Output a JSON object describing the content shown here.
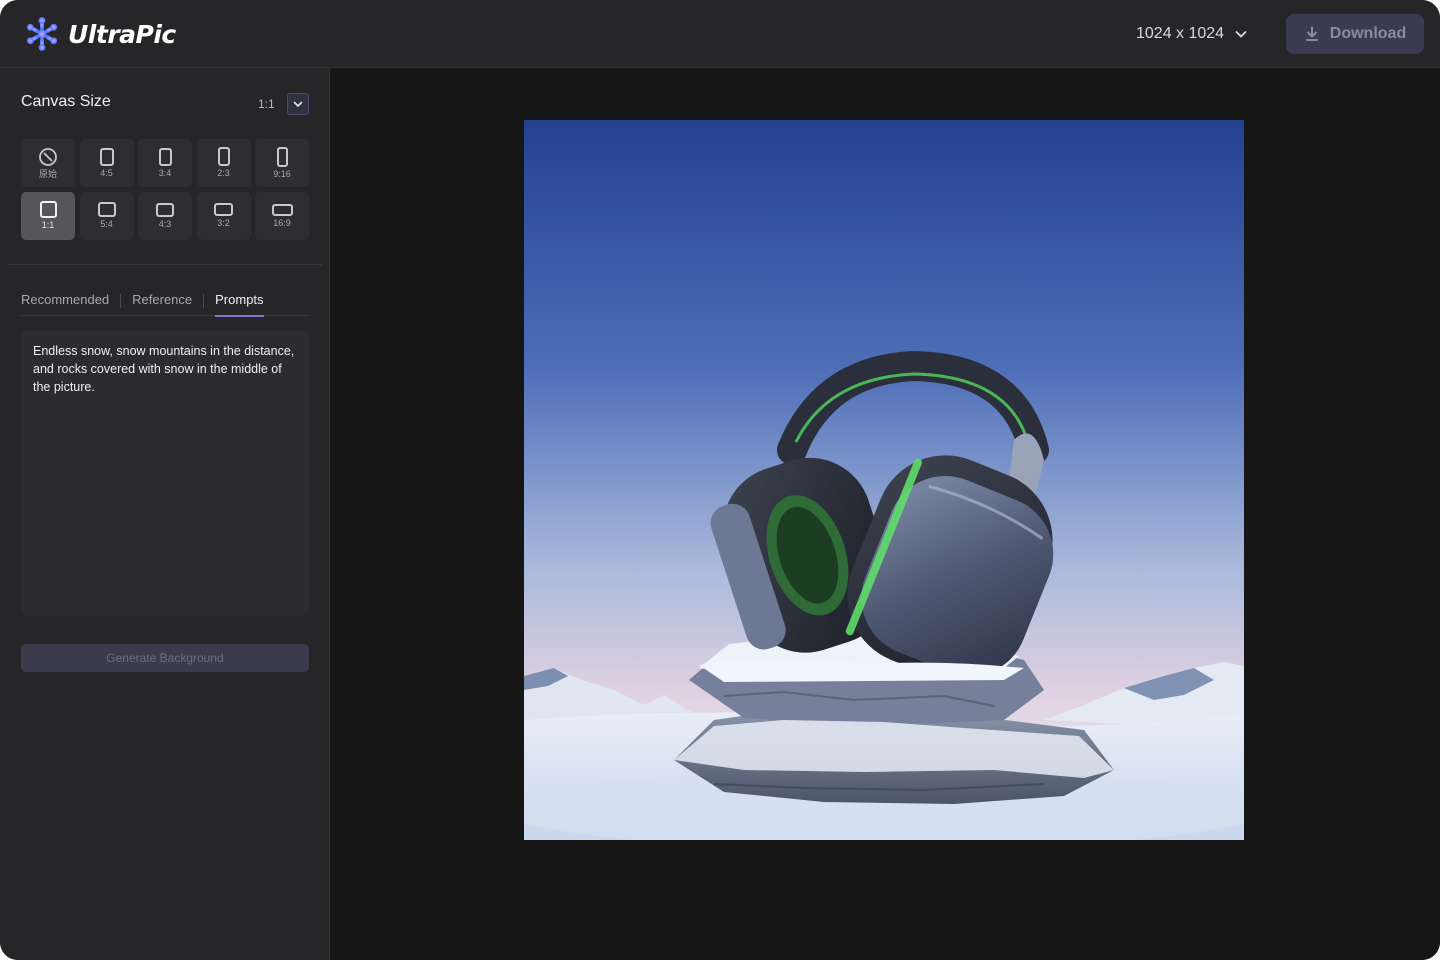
{
  "app": {
    "name": "UltraPic",
    "logo_icon": "snowflake-logo-icon"
  },
  "topbar": {
    "size_value": "1024 x 1024",
    "size_icon": "chevron-down-icon",
    "download_label": "Download",
    "download_icon": "download-icon"
  },
  "sidebar": {
    "canvas_title": "Canvas Size",
    "canvas_ratio": "1:1",
    "ratios": [
      {
        "label": "原始",
        "icon": "no-ratio-icon",
        "active": false
      },
      {
        "label": "4:5",
        "active": false
      },
      {
        "label": "3:4",
        "active": false
      },
      {
        "label": "2:3",
        "active": false
      },
      {
        "label": "9:16",
        "active": false
      },
      {
        "label": "1:1",
        "active": true
      },
      {
        "label": "5:4",
        "active": false
      },
      {
        "label": "4:3",
        "active": false
      },
      {
        "label": "3:2",
        "active": false
      },
      {
        "label": "16:9",
        "active": false
      }
    ],
    "tabs": [
      {
        "label": "Recommended",
        "active": false
      },
      {
        "label": "Reference",
        "active": false
      },
      {
        "label": "Prompts",
        "active": true
      }
    ],
    "prompt_text": "Endless snow, snow mountains in the distance, and rocks covered with snow in the middle of the picture.",
    "generate_label": "Generate Background"
  },
  "colors": {
    "accent": "#7b74d6",
    "app_bg": "#161616",
    "panel_bg": "#262628",
    "button_bg": "#3a3a52"
  }
}
